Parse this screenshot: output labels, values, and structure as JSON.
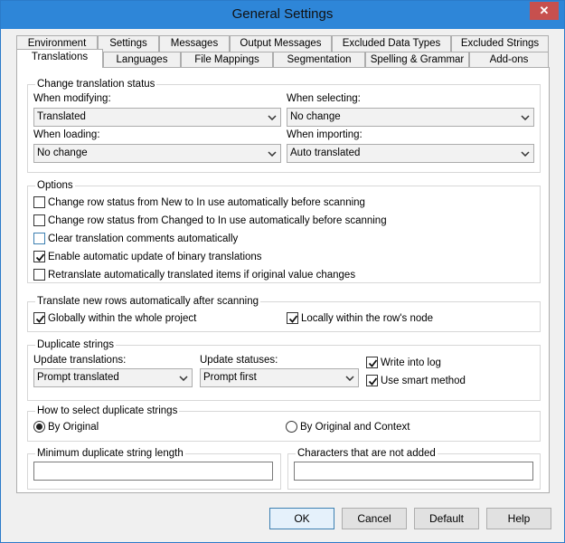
{
  "window": {
    "title": "General Settings",
    "close_glyph": "✕"
  },
  "tabs_row1": [
    "Environment",
    "Settings",
    "Messages",
    "Output Messages",
    "Excluded Data Types",
    "Excluded Strings"
  ],
  "tabs_row2": [
    "Translations",
    "Languages",
    "File Mappings",
    "Segmentation",
    "Spelling & Grammar",
    "Add-ons"
  ],
  "active_tab": "Translations",
  "status_group": {
    "title": "Change translation status",
    "when_modifying_label": "When modifying:",
    "when_modifying_value": "Translated",
    "when_selecting_label": "When selecting:",
    "when_selecting_value": "No change",
    "when_loading_label": "When loading:",
    "when_loading_value": "No change",
    "when_importing_label": "When importing:",
    "when_importing_value": "Auto translated"
  },
  "options_group": {
    "title": "Options",
    "items": [
      {
        "label": "Change row status from New to In use automatically before scanning",
        "checked": false
      },
      {
        "label": "Change row status from Changed to In use automatically before scanning",
        "checked": false
      },
      {
        "label": "Clear translation comments automatically",
        "checked": false
      },
      {
        "label": "Enable automatic update of binary translations",
        "checked": true
      },
      {
        "label": "Retranslate automatically translated items if original value changes",
        "checked": false
      }
    ]
  },
  "new_rows_group": {
    "title": "Translate new rows automatically after scanning",
    "globally_label": "Globally within the whole project",
    "globally_checked": true,
    "locally_label": "Locally within the row's node",
    "locally_checked": true
  },
  "duplicate_group": {
    "title": "Duplicate strings",
    "update_translations_label": "Update translations:",
    "update_translations_value": "Prompt translated",
    "update_statuses_label": "Update statuses:",
    "update_statuses_value": "Prompt first",
    "write_log_label": "Write into log",
    "write_log_checked": true,
    "smart_method_label": "Use smart method",
    "smart_method_checked": true
  },
  "select_group": {
    "title": "How to select duplicate strings",
    "by_original_label": "By Original",
    "by_original_context_label": "By Original and Context",
    "selected": "By Original"
  },
  "min_length_group": {
    "title": "Minimum duplicate string length",
    "value": ""
  },
  "not_added_group": {
    "title": "Characters that are not added",
    "value": ""
  },
  "buttons": {
    "ok": "OK",
    "cancel": "Cancel",
    "default": "Default",
    "help": "Help"
  }
}
